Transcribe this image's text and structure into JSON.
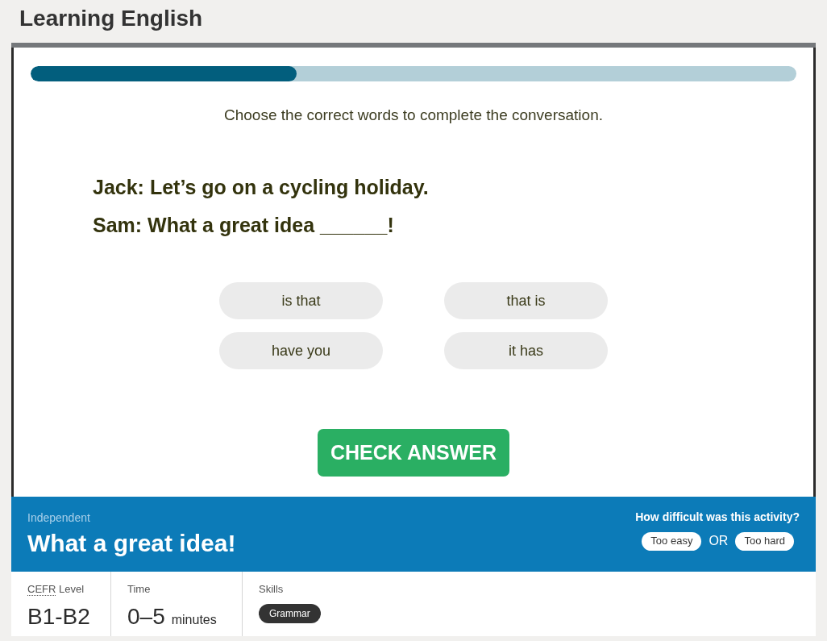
{
  "header": {
    "title": "Learning English"
  },
  "progress": {
    "level": 0.347
  },
  "instruction": "Choose the correct words to complete the conversation.",
  "dialogue": [
    {
      "line": "Jack: Let’s go on a cycling holiday."
    },
    {
      "line": "Sam: What a great idea ______!"
    }
  ],
  "options": [
    {
      "label": "is that",
      "selected": false
    },
    {
      "label": "that is",
      "selected": false
    },
    {
      "label": "have you",
      "selected": false
    },
    {
      "label": "it has",
      "selected": false
    }
  ],
  "check_button": {
    "label": "CHECK ANSWER"
  },
  "activity": {
    "level_name": "Independent",
    "title": "What a great idea!",
    "feedback_question": "How difficult was this activity?",
    "feedback_buttons": [
      "Too easy",
      "Too hard"
    ],
    "separator": "OR"
  },
  "details": [
    {
      "kind": "level",
      "label_abbr": "CEFR",
      "label": "Level",
      "value": "B1-B2"
    },
    {
      "kind": "time",
      "label": "Time",
      "value": "0–5",
      "unit": "minutes"
    },
    {
      "kind": "skills",
      "label": "Skills",
      "tags": [
        "Grammar"
      ]
    }
  ]
}
